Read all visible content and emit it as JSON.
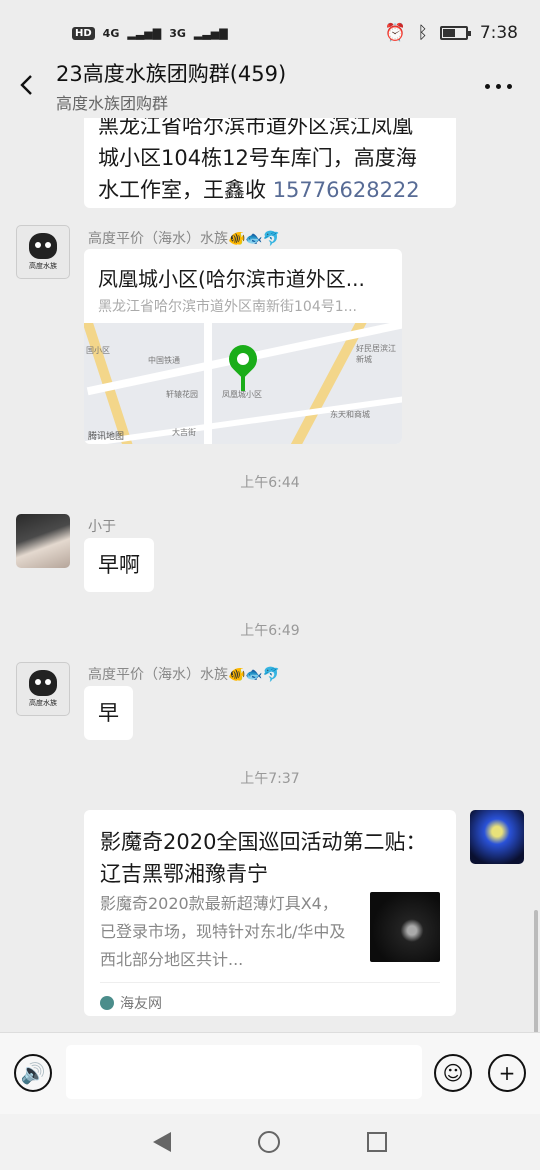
{
  "status": {
    "left_badges": [
      "HD",
      "4G",
      "3G"
    ],
    "time": "7:38",
    "battery_level": 0.5
  },
  "header": {
    "title": "23高度水族团购群(459)",
    "subtitle": "高度水族团购群"
  },
  "messages": {
    "top_address": {
      "line1": "黑龙江省哈尔滨市道外区滨江凤凰",
      "line2": "城小区104栋12号车库门，高度海",
      "line3_prefix": "水工作室，王鑫收 ",
      "phone": "15776628222"
    },
    "location": {
      "sender": "高度平价（海水）水族🐠🐟🐬",
      "title": "凤凰城小区(哈尔滨市道外区...",
      "address": "黑龙江省哈尔滨市道外区南新街104号1...",
      "map_brand": "腾讯地图",
      "map_labels": [
        "中国铁通",
        "凤凰城小区",
        "好民居滨江新城",
        "东天和商城",
        "轩辕花园",
        "大吉街",
        "国小区"
      ]
    },
    "time1": "上午6:44",
    "xiaoyu": {
      "sender": "小于",
      "text": "早啊"
    },
    "time2": "上午6:49",
    "reply": {
      "sender": "高度平价（海水）水族🐠🐟🐬",
      "text": "早"
    },
    "time3": "上午7:37",
    "article": {
      "title": "影魔奇2020全国巡回活动第二贴： 辽吉黑鄂湘豫青宁",
      "desc": "影魔奇2020款最新超薄灯具X4，已登录市场，现特针对东北/华中及西北部分地区共计...",
      "source": "海友网"
    }
  },
  "input": {
    "placeholder": ""
  }
}
